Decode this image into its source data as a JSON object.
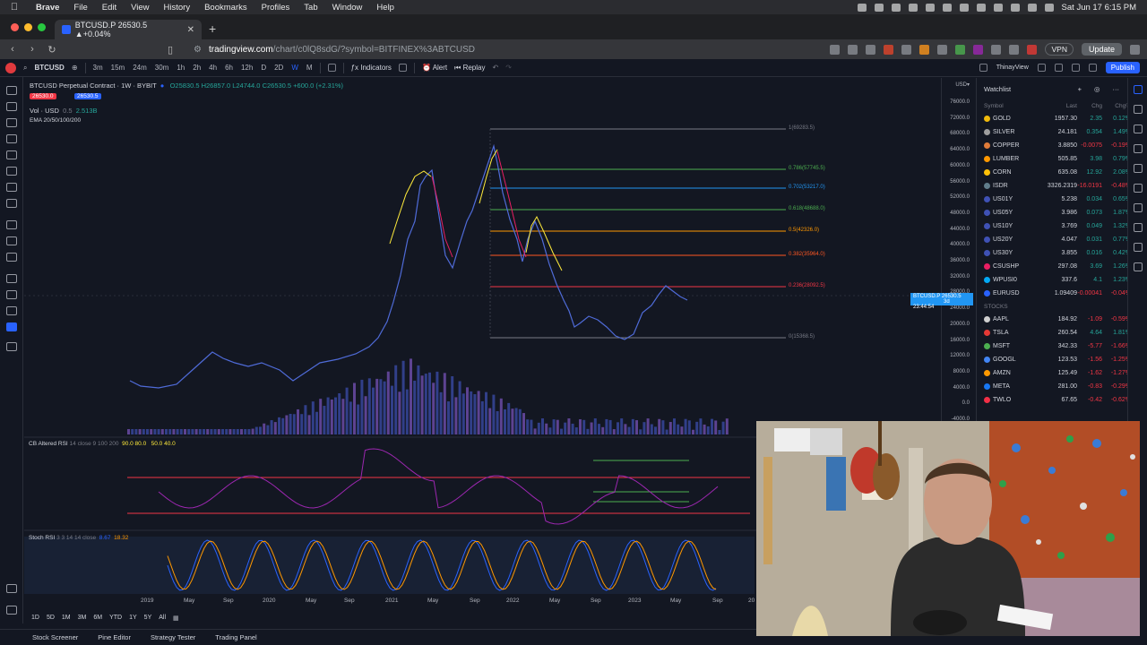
{
  "menubar": {
    "app": "Brave",
    "items": [
      "File",
      "Edit",
      "View",
      "History",
      "Bookmarks",
      "Profiles",
      "Tab",
      "Window",
      "Help"
    ],
    "clock": "Sat Jun 17  6:15 PM"
  },
  "browser": {
    "tab_title": "BTCUSD.P 26530.5 ▲+0.04%",
    "url_host": "tradingview.com",
    "url_path": "/chart/c0lQ8sdG/?symbol=BITFINEX%3ABTCUSD",
    "vpn_label": "VPN",
    "update_label": "Update"
  },
  "toolbar": {
    "symbol": "BTCUSD",
    "timeframes": [
      "3m",
      "15m",
      "24m",
      "30m",
      "1h",
      "2h",
      "4h",
      "6h",
      "12h",
      "D",
      "2D",
      "W",
      "M"
    ],
    "active_timeframe": "W",
    "indicators_label": "Indicators",
    "alert_label": "Alert",
    "replay_label": "Replay",
    "layout_name": "ThinayView",
    "publish_label": "Publish"
  },
  "legend": {
    "title": "BTCUSD Perpetual Contract · 1W · BYBIT",
    "ohlc": "O25830.5  H26857.0  L24744.0  C26530.5  +600.0 (+2.31%)",
    "price_tag_1": "26530.0",
    "price_tag_2": "26530.5",
    "vol_label": "Vol · USD",
    "vol_value": "2.513B",
    "vol_mult": "0.5",
    "ema_label": "EMA 20/50/100/200"
  },
  "fib_levels": [
    {
      "label": "1(69283.5)",
      "color": "#787b86"
    },
    {
      "label": "0.786(57745.5)",
      "color": "#4caf50"
    },
    {
      "label": "0.702(53217.0)",
      "color": "#2196f3"
    },
    {
      "label": "0.618(48688.0)",
      "color": "#4caf50"
    },
    {
      "label": "0.5(42326.0)",
      "color": "#ff9800"
    },
    {
      "label": "0.382(35964.0)",
      "color": "#ff5722"
    },
    {
      "label": "0.236(28092.5)",
      "color": "#f23645"
    },
    {
      "label": "0(15368.5)",
      "color": "#787b86"
    }
  ],
  "price_axis": [
    "USD▾",
    "76000.0",
    "72000.0",
    "68000.0",
    "64000.0",
    "60000.0",
    "56000.0",
    "52000.0",
    "48000.0",
    "44000.0",
    "40000.0",
    "36000.0",
    "32000.0",
    "28000.0",
    "24000.0",
    "20000.0",
    "16000.0",
    "12000.0",
    "8000.0",
    "4000.0",
    "0.0",
    "-4000.0"
  ],
  "price_now": {
    "symbol": "BTCUSD.P",
    "value": "26530.5",
    "countdown": "3d 23:44:54"
  },
  "rsi_panel": {
    "title": "CB Altered RSI",
    "params": "14 close 9 100 200",
    "levels_a": "90.0  80.0",
    "levels_b": "50.0  40.0"
  },
  "stoch_panel": {
    "title": "Stoch RSI",
    "params": "3 3 14 14 close",
    "k": "8.67",
    "d": "18.32"
  },
  "time_axis": [
    "2019",
    "May",
    "Sep",
    "2020",
    "May",
    "Sep",
    "2021",
    "May",
    "Sep",
    "2022",
    "May",
    "Sep",
    "2023",
    "May",
    "Sep",
    "20"
  ],
  "ranges": [
    "1D",
    "5D",
    "1M",
    "3M",
    "6M",
    "YTD",
    "1Y",
    "5Y",
    "All"
  ],
  "bottom_tabs": [
    "Stock Screener",
    "Pine Editor",
    "Strategy Tester",
    "Trading Panel"
  ],
  "watchlist": {
    "title": "Watchlist",
    "columns": [
      "Symbol",
      "Last",
      "Chg",
      "Chg%"
    ],
    "rows": [
      {
        "sym": "GOLD",
        "last": "1957.30",
        "chg": "2.35",
        "pct": "0.12%",
        "dir": "up",
        "color": "#f0b90b"
      },
      {
        "sym": "SILVER",
        "last": "24.181",
        "chg": "0.354",
        "pct": "1.49%",
        "dir": "up",
        "color": "#9e9e9e"
      },
      {
        "sym": "COPPER",
        "last": "3.8850",
        "chg": "-0.0075",
        "pct": "-0.19%",
        "dir": "dn",
        "color": "#e07b39"
      },
      {
        "sym": "LUMBER",
        "last": "505.85",
        "chg": "3.98",
        "pct": "0.79%",
        "dir": "up",
        "color": "#ff9800"
      },
      {
        "sym": "CORN",
        "last": "635.08",
        "chg": "12.92",
        "pct": "2.08%",
        "dir": "up",
        "color": "#ffc107"
      },
      {
        "sym": "ISDR",
        "last": "3326.2319",
        "chg": "-16.0191",
        "pct": "-0.48%",
        "dir": "dn",
        "color": "#607d8b"
      },
      {
        "sym": "US01Y",
        "last": "5.238",
        "chg": "0.034",
        "pct": "0.65%",
        "dir": "up",
        "color": "#3f51b5"
      },
      {
        "sym": "US05Y",
        "last": "3.986",
        "chg": "0.073",
        "pct": "1.87%",
        "dir": "up",
        "color": "#3f51b5"
      },
      {
        "sym": "US10Y",
        "last": "3.769",
        "chg": "0.049",
        "pct": "1.32%",
        "dir": "up",
        "color": "#3f51b5"
      },
      {
        "sym": "US20Y",
        "last": "4.047",
        "chg": "0.031",
        "pct": "0.77%",
        "dir": "up",
        "color": "#3f51b5"
      },
      {
        "sym": "US30Y",
        "last": "3.855",
        "chg": "0.016",
        "pct": "0.42%",
        "dir": "up",
        "color": "#3f51b5"
      },
      {
        "sym": "CSUSHP",
        "last": "297.08",
        "chg": "3.69",
        "pct": "1.26%",
        "dir": "up",
        "color": "#e91e63"
      },
      {
        "sym": "WPUSI0",
        "last": "337.6",
        "chg": "4.1",
        "pct": "1.23%",
        "dir": "up",
        "color": "#03a9f4"
      },
      {
        "sym": "EURUSD",
        "last": "1.09409",
        "chg": "-0.00041",
        "pct": "-0.04%",
        "dir": "dn",
        "color": "#2962ff"
      }
    ],
    "section": "STOCKS",
    "stocks": [
      {
        "sym": "AAPL",
        "last": "184.92",
        "chg": "-1.09",
        "pct": "-0.59%",
        "dir": "dn",
        "color": "#cfcfcf"
      },
      {
        "sym": "TSLA",
        "last": "260.54",
        "chg": "4.64",
        "pct": "1.81%",
        "dir": "up",
        "color": "#e53935"
      },
      {
        "sym": "MSFT",
        "last": "342.33",
        "chg": "-5.77",
        "pct": "-1.66%",
        "dir": "dn",
        "color": "#4caf50"
      },
      {
        "sym": "GOOGL",
        "last": "123.53",
        "chg": "-1.56",
        "pct": "-1.25%",
        "dir": "dn",
        "color": "#4285f4"
      },
      {
        "sym": "AMZN",
        "last": "125.49",
        "chg": "-1.62",
        "pct": "-1.27%",
        "dir": "dn",
        "color": "#ff9900"
      },
      {
        "sym": "META",
        "last": "281.00",
        "chg": "-0.83",
        "pct": "-0.29%",
        "dir": "dn",
        "color": "#1877f2"
      },
      {
        "sym": "TWLO",
        "last": "67.65",
        "chg": "-0.42",
        "pct": "-0.62%",
        "dir": "dn",
        "color": "#f22f46"
      }
    ]
  },
  "colors": {
    "accent": "#2962ff",
    "up": "#26a69a",
    "down": "#f23645",
    "bg": "#131722"
  }
}
